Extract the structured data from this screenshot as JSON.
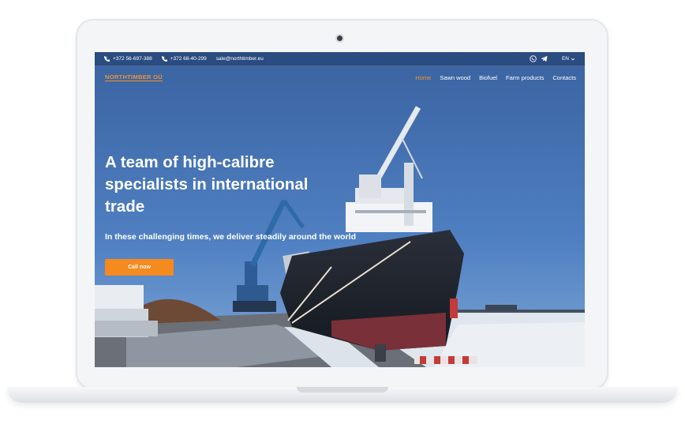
{
  "topbar": {
    "phone1": "+372 56-697-388",
    "phone2": "+372 68-40-299",
    "email": "sale@northtimber.eu",
    "language": "EN"
  },
  "nav": {
    "logo": "NORTHTIMBER OÜ",
    "items": [
      "Home",
      "Sawn wood",
      "Biofuel",
      "Farm products",
      "Contacts"
    ],
    "active": "Home"
  },
  "hero": {
    "headline": "A team of high-calibre specialists in international trade",
    "subheadline": "In these challenging times, we deliver steadily around the world",
    "cta_label": "Call now"
  },
  "colors": {
    "accent": "#f58a1f",
    "sky": "#3f69a6",
    "ship_hull": "#1e2430"
  },
  "icons": [
    "phone-icon",
    "whatsapp-icon",
    "telegram-icon",
    "chevron-down-icon",
    "camera-icon"
  ]
}
